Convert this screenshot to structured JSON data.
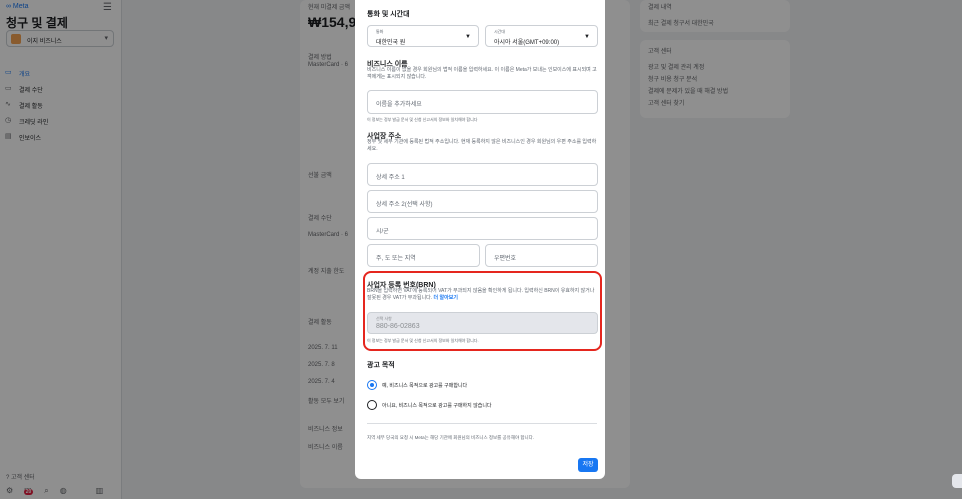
{
  "app": {
    "logo": "∞ Meta",
    "title": "청구 및 결제"
  },
  "sidebar": {
    "account_name": "이지 비즈니스",
    "items": [
      {
        "label": "개요",
        "icon": "overview-icon",
        "active": true
      },
      {
        "label": "결제 수단",
        "icon": "card-icon",
        "active": false
      },
      {
        "label": "결제 활동",
        "icon": "activity-icon",
        "active": false
      },
      {
        "label": "크레딧 라인",
        "icon": "credit-icon",
        "active": false
      },
      {
        "label": "인보이스",
        "icon": "invoice-icon",
        "active": false
      }
    ],
    "help": "? 고객 센터"
  },
  "background": {
    "amount_label": "현재 미결제 금액",
    "amount_value": "₩154,913",
    "payment_method_label": "결제 방법",
    "card_label": "MasterCard · 6",
    "balance_label": "선불 금액",
    "payment_section": "결제 수단",
    "card_label2": "MasterCard · 6",
    "spend_limit": "계정 지출 한도",
    "activity": "결제 활동",
    "dates": [
      "2025. 7. 11",
      "2025. 7. 8",
      "2025. 7. 4"
    ],
    "view_all": "활동 모두 보기",
    "biz_info": "비즈니스 정보",
    "biz_name": "비즈니스 이름",
    "right_panel_title": "결제 내역",
    "right_panel_link": "최근 결제 청구서 대한민국",
    "help_center": "고객 센터",
    "help_links": [
      "광고 및 결제 관리 계정",
      "청구 비용 청구 분석",
      "결제에 문제가 있을 때 해결 방법",
      "고객 센터 찾기"
    ]
  },
  "modal": {
    "currency_tz": {
      "title": "통화 및 시간대",
      "currency_label": "통화",
      "currency_value": "대한민국 원",
      "tz_label": "시간대",
      "tz_value": "아시아 서울(GMT+09:00)"
    },
    "biz_name": {
      "title": "비즈니스 이름",
      "desc": "비즈니스 이름이 없을 경우 회원님의 법적 이름을 입력하세요. 이 이름은 Meta가 보내는 인보이스에 표시되며 고객에게는 표시되지 않습니다.",
      "placeholder": "이름을 추가하세요",
      "helper": "이 정보는 정부 발급 문서 및 신청 신고서의 정보와 일치해야 합니다"
    },
    "address": {
      "title": "사업장 주소",
      "desc": "정부 및 세무 기관에 등록된 법적 주소입니다. 현재 등록하지 않은 비즈니스인 경우 회원님의 우편 주소를 입력하세요.",
      "line1": "상세 주소 1",
      "line2": "상세 주소 2(선택 사항)",
      "city": "시/군",
      "state": "주, 도 또는 지역",
      "zip": "우편번호"
    },
    "brn": {
      "title": "사업자 등록 번호(BRN)",
      "desc": "BRN을 입력하면 VAT에 등록되어 VAT가 부과되지 않음을 확인하게 됩니다. 입력하신 BRN이 유효하지 않거나 잘못된 경우 VAT가 부과됩니다.",
      "learn_more": "더 알아보기",
      "field_label": "선택 사항",
      "field_value": "880-86-02863",
      "helper": "이 정보는 정부 발급 문서 및 신청 신고서의 정보와 일치해야 합니다."
    },
    "purpose": {
      "title": "광고 목적",
      "option_yes": "예, 비즈니스 목적으로 광고를 구매합니다",
      "option_no": "아니요, 비즈니스 목적으로 광고를 구매하지 않습니다",
      "selected": "yes"
    },
    "footer_note": "지역 세무 당국의 요청 시 Meta는 해당 기관에 회원님의 비즈니스 정보를 공유해야 합니다.",
    "save_label": "저장"
  },
  "colors": {
    "accent": "#1877f2",
    "highlight": "#e5261e"
  }
}
